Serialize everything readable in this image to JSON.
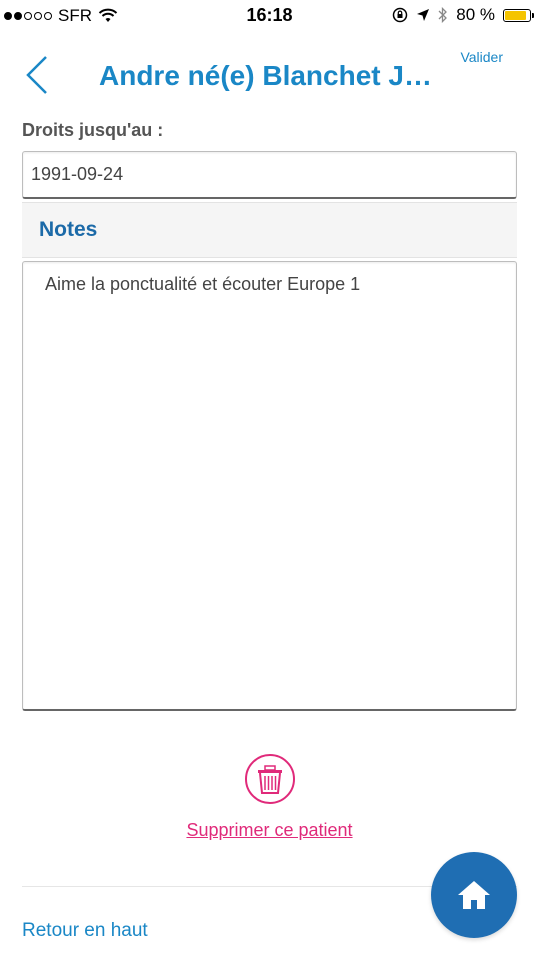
{
  "status_bar": {
    "carrier": "SFR",
    "time": "16:18",
    "battery_percent": "80 %",
    "battery_level": 0.8,
    "icons": [
      "signal-dots",
      "wifi-icon",
      "rotation-lock-icon",
      "location-icon",
      "bluetooth-icon",
      "battery-icon"
    ]
  },
  "nav": {
    "title": "Andre né(e) Blanchet J…",
    "validate_label": "Valider",
    "back_icon": "chevron-left-icon"
  },
  "form": {
    "rights_label": "Droits jusqu'au :",
    "rights_value": "1991-09-24",
    "notes_header": "Notes",
    "notes_value": "Aime la ponctualité et écouter Europe 1"
  },
  "actions": {
    "delete_icon": "trash-icon",
    "delete_label": "Supprimer ce patient",
    "back_to_top": "Retour en haut",
    "home_icon": "home-icon"
  },
  "colors": {
    "accent": "#1a87c6",
    "section_title": "#1c6aa8",
    "delete": "#e02a7a",
    "fab": "#1f6eb3"
  }
}
